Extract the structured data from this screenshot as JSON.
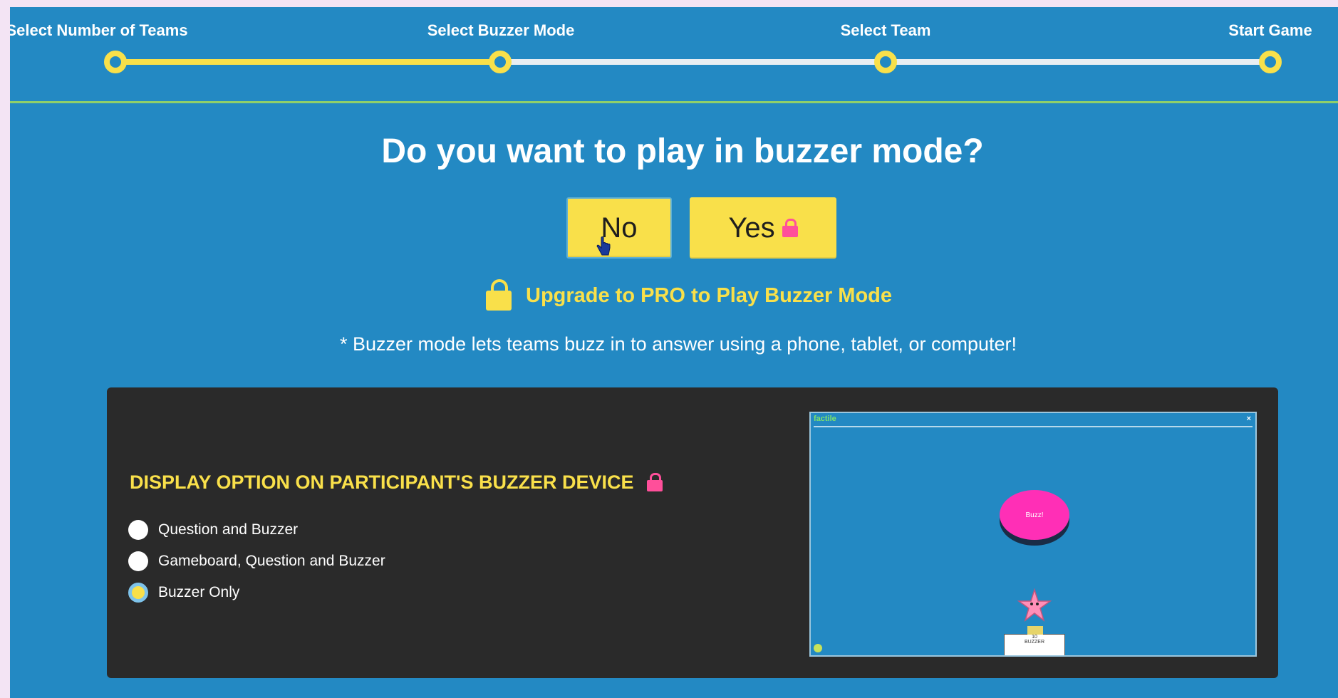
{
  "stepper": {
    "steps": [
      {
        "label": "Select Number of Teams",
        "state": "done"
      },
      {
        "label": "Select Buzzer Mode",
        "state": "current"
      },
      {
        "label": "Select Team",
        "state": "upcoming"
      },
      {
        "label": "Start Game",
        "state": "upcoming"
      }
    ],
    "progress_color": "#f9e04a",
    "track_color": "#e8eef2"
  },
  "question": {
    "title": "Do you want to play in buzzer mode?",
    "no_label": "No",
    "yes_label": "Yes"
  },
  "upgrade": {
    "label": "Upgrade to PRO to Play Buzzer Mode",
    "icon": "lock-icon"
  },
  "hint": "* Buzzer mode lets teams buzz in to answer using a phone, tablet, or computer!",
  "display_options": {
    "title": "DISPLAY OPTION ON PARTICIPANT'S BUZZER DEVICE",
    "options": [
      {
        "label": "Question and Buzzer",
        "selected": false
      },
      {
        "label": "Gameboard, Question and Buzzer",
        "selected": false
      },
      {
        "label": "Buzzer Only",
        "selected": true
      }
    ]
  },
  "preview": {
    "app_name": "factile",
    "close": "×",
    "buzzer_label": "Buzz!",
    "podium_score": "10",
    "podium_name": "BUZZER"
  },
  "colors": {
    "background": "#2389c3",
    "accent": "#f9e04a",
    "lock_pink": "#ff4f9a",
    "panel": "#2a2a2a"
  }
}
